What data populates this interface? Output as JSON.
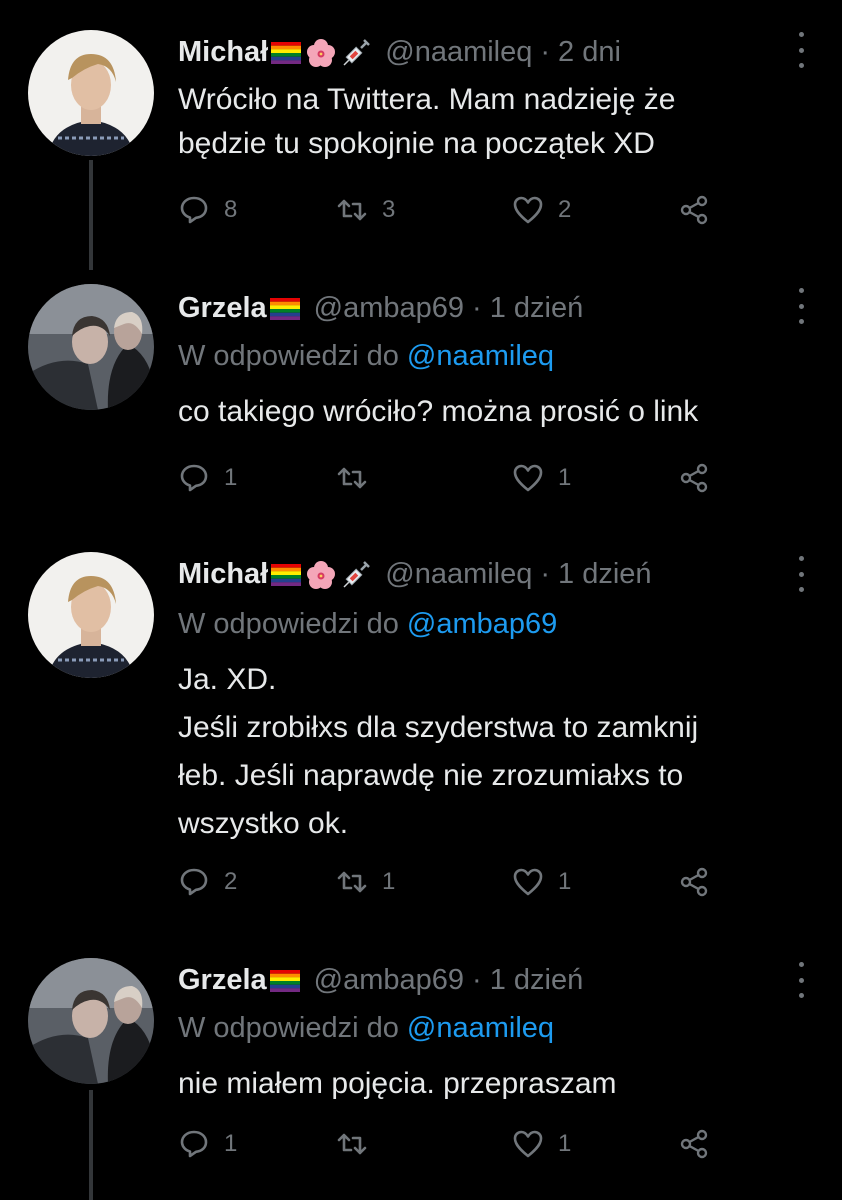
{
  "tweets": [
    {
      "name": "Michał",
      "handle": "@naamileq",
      "sep": "·",
      "time": "2 dni",
      "has_flower": true,
      "has_syringe": true,
      "reply_prefix": "",
      "reply_to": "",
      "lines": [
        "Wróciło na Twittera. Mam nadzieję że",
        "będzie tu spokojnie na początek XD"
      ],
      "replies": "8",
      "retweets": "3",
      "likes": "2"
    },
    {
      "name": "Grzela",
      "handle": "@ambap69",
      "sep": "·",
      "time": "1 dzień",
      "has_flower": false,
      "has_syringe": false,
      "reply_prefix": "W odpowiedzi do",
      "reply_to": "@naamileq",
      "lines": [
        "co takiego wróciło? można prosić o link"
      ],
      "replies": "1",
      "retweets": "",
      "likes": "1"
    },
    {
      "name": "Michał",
      "handle": "@naamileq",
      "sep": "·",
      "time": "1 dzień",
      "has_flower": true,
      "has_syringe": true,
      "reply_prefix": "W odpowiedzi do",
      "reply_to": "@ambap69",
      "lines": [
        "Ja. XD.",
        "Jeśli zrobiłxs dla szyderstwa to zamknij",
        "łeb. Jeśli naprawdę nie zrozumiałxs to",
        "wszystko ok."
      ],
      "replies": "2",
      "retweets": "1",
      "likes": "1"
    },
    {
      "name": "Grzela",
      "handle": "@ambap69",
      "sep": "·",
      "time": "1 dzień",
      "has_flower": false,
      "has_syringe": false,
      "reply_prefix": "W odpowiedzi do",
      "reply_to": "@naamileq",
      "lines": [
        "nie miałem pojęcia. przepraszam"
      ],
      "replies": "1",
      "retweets": "",
      "likes": "1"
    }
  ],
  "icons": {
    "reply": "reply-icon",
    "retweet": "retweet-icon",
    "like": "heart-icon",
    "share": "share-icon",
    "more": "more-options-icon"
  },
  "colors": {
    "background": "#000000",
    "text": "#e7e9ea",
    "muted": "#71767b",
    "link": "#1d9bf0"
  }
}
